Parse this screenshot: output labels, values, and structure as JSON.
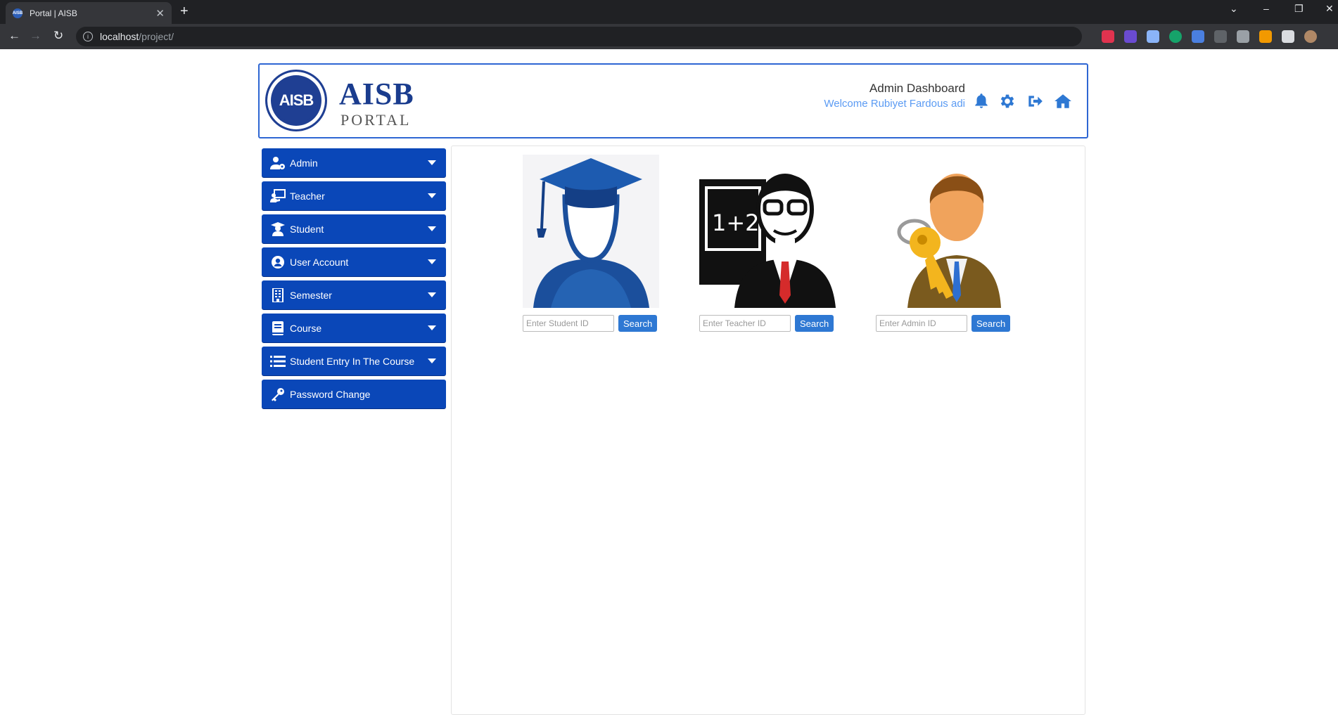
{
  "browser": {
    "tab_title": "Portal | AISB",
    "favicon_text": "AISB",
    "url_host": "localhost",
    "url_path": "/project/"
  },
  "header": {
    "logo_text": "AISB",
    "brand_title": "AISB",
    "brand_subtitle": "PORTAL",
    "dashboard_title": "Admin Dashboard",
    "welcome_text": "Welcome Rubiyet Fardous adi",
    "icons": [
      "bell-icon",
      "gear-icon",
      "sign-out-icon",
      "home-icon"
    ]
  },
  "sidebar": {
    "items": [
      {
        "label": "Admin",
        "icon": "user-cog-icon",
        "dropdown": true
      },
      {
        "label": "Teacher",
        "icon": "chalkboard-teacher-icon",
        "dropdown": true
      },
      {
        "label": "Student",
        "icon": "graduate-icon",
        "dropdown": true
      },
      {
        "label": "User Account",
        "icon": "user-circle-icon",
        "dropdown": true
      },
      {
        "label": "Semester",
        "icon": "building-icon",
        "dropdown": true
      },
      {
        "label": "Course",
        "icon": "book-icon",
        "dropdown": true
      },
      {
        "label": "Student Entry In The Course",
        "icon": "list-icon",
        "dropdown": true
      },
      {
        "label": "Password Change",
        "icon": "key-icon",
        "dropdown": false
      }
    ]
  },
  "search_cards": {
    "student": {
      "placeholder": "Enter Student ID",
      "button": "Search"
    },
    "teacher": {
      "placeholder": "Enter Teacher ID",
      "button": "Search",
      "board_text": "1+2"
    },
    "admin": {
      "placeholder": "Enter Admin ID",
      "button": "Search"
    }
  },
  "colors": {
    "primary": "#0a47b8",
    "accent": "#2e78d3",
    "brand": "#1a3c8e",
    "welcome": "#5b9bf3"
  }
}
